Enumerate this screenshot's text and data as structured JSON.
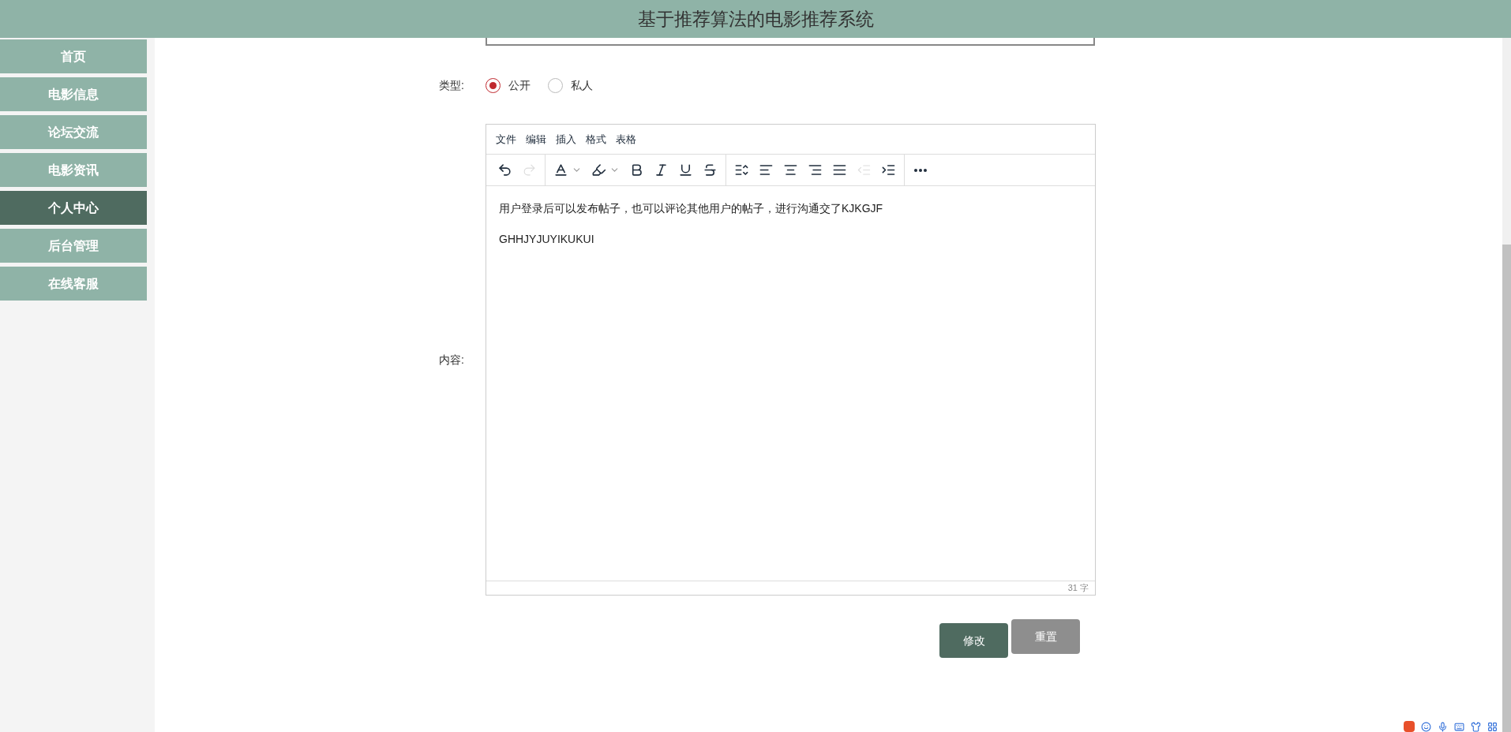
{
  "header": {
    "title": "基于推荐算法的电影推荐系统"
  },
  "sidebar": {
    "items": [
      {
        "label": "首页",
        "selected": false
      },
      {
        "label": "电影信息",
        "selected": false
      },
      {
        "label": "论坛交流",
        "selected": false
      },
      {
        "label": "电影资讯",
        "selected": false
      },
      {
        "label": "个人中心",
        "selected": true
      },
      {
        "label": "后台管理",
        "selected": false
      },
      {
        "label": "在线客服",
        "selected": false
      }
    ]
  },
  "form": {
    "type_field": {
      "label": "类型:",
      "options": [
        {
          "label": "公开",
          "selected": true
        },
        {
          "label": "私人",
          "selected": false
        }
      ]
    },
    "content_field": {
      "label": "内容:",
      "editor": {
        "menu": [
          "文件",
          "编辑",
          "插入",
          "格式",
          "表格"
        ],
        "toolbar_groups": [
          [
            {
              "kind": "undo",
              "disabled": false
            },
            {
              "kind": "redo",
              "disabled": true
            }
          ],
          [
            {
              "kind": "forecolor",
              "disabled": false
            },
            {
              "kind": "backcolor",
              "disabled": false
            },
            {
              "kind": "bold",
              "disabled": false
            },
            {
              "kind": "italic",
              "disabled": false
            },
            {
              "kind": "underline",
              "disabled": false
            },
            {
              "kind": "strike",
              "disabled": false
            }
          ],
          [
            {
              "kind": "lineheight",
              "disabled": false
            },
            {
              "kind": "alignleft",
              "disabled": false
            },
            {
              "kind": "aligncenter",
              "disabled": false
            },
            {
              "kind": "alignright",
              "disabled": false
            },
            {
              "kind": "alignjustify",
              "disabled": false
            },
            {
              "kind": "outdent",
              "disabled": true
            },
            {
              "kind": "indent",
              "disabled": false
            }
          ],
          [
            {
              "kind": "more",
              "disabled": false
            }
          ]
        ],
        "paragraphs": [
          "用户登录后可以发布帖子，也可以评论其他用户的帖子，进行沟通交了KJKGJF",
          "GHHJYJUYIKUKUI"
        ],
        "word_count": "31 字"
      }
    },
    "buttons": [
      {
        "kind": "primary",
        "label": "修改"
      },
      {
        "kind": "secondary",
        "label": "重置"
      }
    ]
  }
}
